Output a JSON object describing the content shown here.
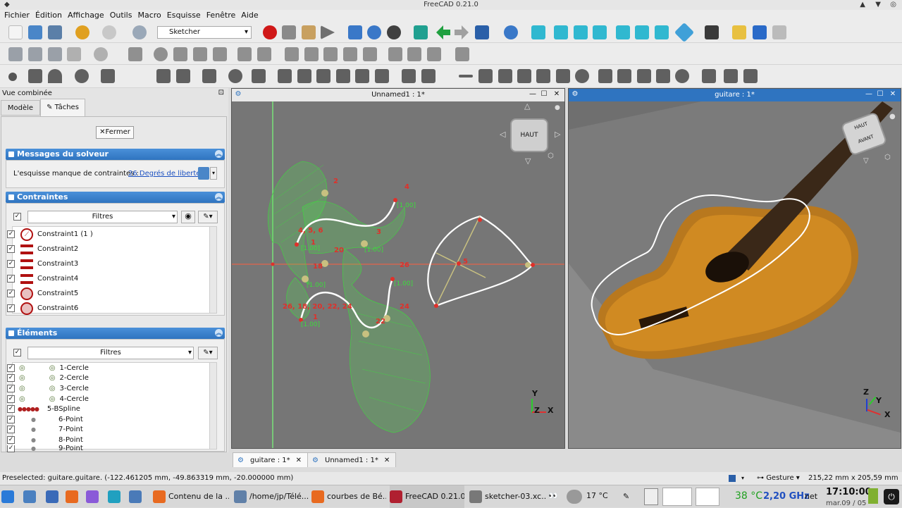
{
  "window": {
    "title": "FreeCAD 0.21.0"
  },
  "menu": [
    "Fichier",
    "Édition",
    "Affichage",
    "Outils",
    "Macro",
    "Esquisse",
    "Fenêtre",
    "Aide"
  ],
  "workbench": "Sketcher",
  "combo": {
    "title": "Vue combinée",
    "tab_model": "Modèle",
    "tab_tasks": "Tâches",
    "close_label": "Fermer"
  },
  "solver": {
    "title": "Messages du solveur",
    "message": "L'esquisse manque de contraintes :",
    "dof_link": "26 Degrés de liberté"
  },
  "constraints": {
    "title": "Contraintes",
    "filter": "Filtres",
    "items": [
      "Constraint1 (1 )",
      "Constraint2",
      "Constraint3",
      "Constraint4",
      "Constraint5",
      "Constraint6"
    ]
  },
  "elements": {
    "title": "Éléments",
    "filter": "Filtres",
    "items": [
      "1-Cercle",
      "2-Cercle",
      "3-Cercle",
      "4-Cercle",
      "5-BSpline",
      "6-Point",
      "7-Point",
      "8-Point",
      "9-Point"
    ]
  },
  "views": {
    "left_title": "Unnamed1 : 1*",
    "right_title": "guitare : 1*",
    "cube_left": "HAUT",
    "cube_right_top": "HAUT",
    "cube_right_front": "AVANT",
    "axis_x": "X",
    "axis_y": "Y",
    "axis_z": "Z"
  },
  "sketch_labels": {
    "c2": "2",
    "c4": "4",
    "c456": "4, 5, 6",
    "c1a": "1",
    "c20": "20",
    "c18": "18",
    "c26": "26",
    "c26b": "26, 18, 20, 22, 24",
    "c1b": "1",
    "c24": "24",
    "c22": "22",
    "c3": "3",
    "c5": "5",
    "w1": "[1.00]",
    "w2": "[1.00]",
    "w3": "[1.00]",
    "w4": "[1.00]",
    "w5": "[1.00]",
    "w6": "[1.00]"
  },
  "doc_tabs": [
    "guitare : 1*",
    "Unnamed1 : 1*"
  ],
  "status": {
    "preselected": "Preselected: guitare.guitare. (-122.461205 mm, -49.863319 mm, -20.000000 mm)",
    "nav": "Gesture",
    "dims": "215,22 mm x 205,59 mm"
  },
  "taskbar": {
    "items": [
      "Contenu de la ...",
      "/home/jp/Télé...",
      "courbes de Bé...",
      "FreeCAD 0.21.0",
      "sketcher-03.xc..."
    ],
    "weather": "17 °C",
    "temp": "38 °C",
    "cpu": "2,20 GHz",
    "net": "net",
    "time": "17:10:00",
    "date": "mar.09 / 05"
  },
  "colors": {
    "accent": "#2f74c0",
    "sketch": "#3cdc3c",
    "constraint": "#e0302a"
  }
}
